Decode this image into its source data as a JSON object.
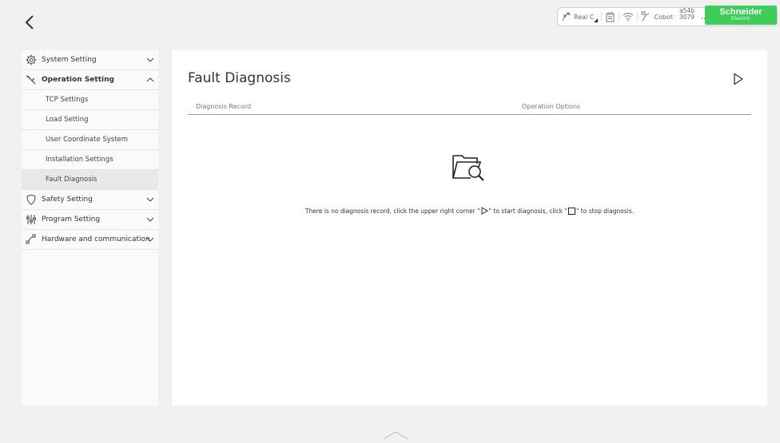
{
  "status_bar": {
    "mode": "Real C",
    "robot_label": "Cobot",
    "id_line1": "a54b",
    "id_line2": "3079",
    "more": "..."
  },
  "brand": {
    "name": "Schneider",
    "sub": "Electric",
    "color": "#3dcd58"
  },
  "sidebar": {
    "sections": [
      {
        "label": "System Setting",
        "icon": "gear-icon",
        "expanded": false
      },
      {
        "label": "Operation Setting",
        "icon": "wrench-icon",
        "expanded": true,
        "items": [
          "TCP Settings",
          "Load Setting",
          "User Coordinate System",
          "Installation Settings",
          "Fault Diagnosis"
        ],
        "active_item": "Fault Diagnosis"
      },
      {
        "label": "Safety Setting",
        "icon": "shield-icon",
        "expanded": false
      },
      {
        "label": "Program Setting",
        "icon": "program-icon",
        "expanded": false
      },
      {
        "label": "Hardware and communication",
        "icon": "network-icon",
        "expanded": false
      }
    ]
  },
  "main": {
    "title": "Fault Diagnosis",
    "columns": [
      "Diagnosis Record",
      "Operation Options"
    ],
    "empty_text_1": "There is no diagnosis record, click the upper right corner \"",
    "empty_text_2": "\" to start diagnosis, click \"",
    "empty_text_3": "\" to stop diagnosis."
  }
}
